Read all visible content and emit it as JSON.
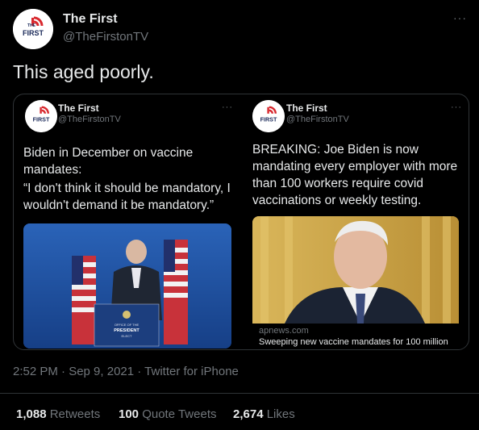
{
  "tweet": {
    "author_name": "The First",
    "author_handle": "@TheFirstonTV",
    "logo_text": "FIRST",
    "logo_small": "THE",
    "more": "···",
    "text": "This aged poorly.",
    "meta": "2:52 PM · Sep 9, 2021 · Twitter for iPhone"
  },
  "quoted": [
    {
      "author_name": "The First",
      "author_handle": "@TheFirstonTV",
      "more": "···",
      "lines": [
        "Biden in December on vaccine",
        "mandates:",
        "“I don't think it should be mandatory, I",
        "wouldn't demand it be mandatory.”"
      ],
      "podium_label_1": "OFFICE OF THE",
      "podium_label_2": "PRESIDENT",
      "podium_label_3": "ELECT"
    },
    {
      "author_name": "The First",
      "author_handle": "@TheFirstonTV",
      "more": "···",
      "lines": [
        "BREAKING: Joe Biden is now",
        "mandating every employer with more",
        "than 100 workers require covid",
        "vaccinations or weekly testing."
      ],
      "card_domain": "apnews.com",
      "card_title": "Sweeping new vaccine mandates for 100 million"
    }
  ],
  "stats": [
    {
      "num": "1,088",
      "label": "Retweets"
    },
    {
      "num": "100",
      "label": "Quote Tweets"
    },
    {
      "num": "2,674",
      "label": "Likes"
    }
  ],
  "colors": {
    "background": "#000000",
    "border": "#2f3336",
    "logo_red": "#d8282e",
    "logo_navy": "#1b2a5a",
    "muted": "#71767b"
  }
}
